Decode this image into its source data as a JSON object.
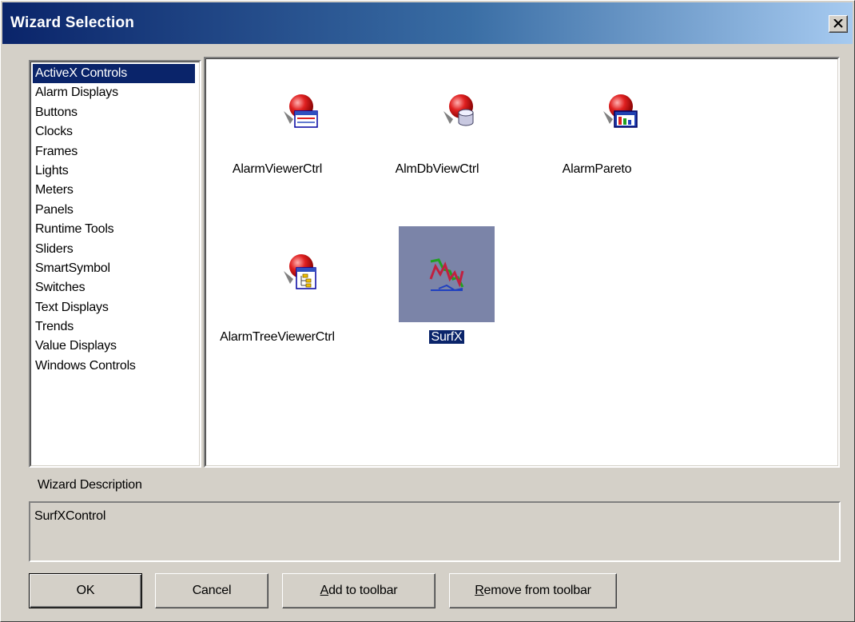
{
  "window": {
    "title": "Wizard Selection",
    "close_symbol": "×"
  },
  "categories": {
    "selected_index": 0,
    "items": [
      "ActiveX Controls",
      "Alarm Displays",
      "Buttons",
      "Clocks",
      "Frames",
      "Lights",
      "Meters",
      "Panels",
      "Runtime Tools",
      "Sliders",
      "SmartSymbol",
      "Switches",
      "Text Displays",
      "Trends",
      "Value Displays",
      "Windows Controls"
    ]
  },
  "wizards": {
    "selected": "SurfX",
    "items": [
      {
        "label": "AlarmViewerCtrl",
        "icon": "alarm-viewer-icon"
      },
      {
        "label": "AlmDbViewCtrl",
        "icon": "alarm-db-view-icon"
      },
      {
        "label": "AlarmPareto",
        "icon": "alarm-pareto-icon"
      },
      {
        "label": "AlarmTreeViewerCtrl",
        "icon": "alarm-tree-viewer-icon"
      },
      {
        "label": "SurfX",
        "icon": "surfx-chart-icon"
      }
    ]
  },
  "description": {
    "label": "Wizard Description",
    "text": "SurfXControl"
  },
  "buttons": {
    "ok": "OK",
    "cancel": "Cancel",
    "add_to_toolbar_accel": "A",
    "add_to_toolbar_rest": "dd to toolbar",
    "remove_from_toolbar_accel": "R",
    "remove_from_toolbar_rest": "emove from  toolbar"
  },
  "colors": {
    "titlebar_start": "#0a246a",
    "titlebar_end": "#a6caf0",
    "dialog_face": "#d4d0c8",
    "selection": "#0a246a",
    "icon_selection_bg": "#7b84a8"
  }
}
